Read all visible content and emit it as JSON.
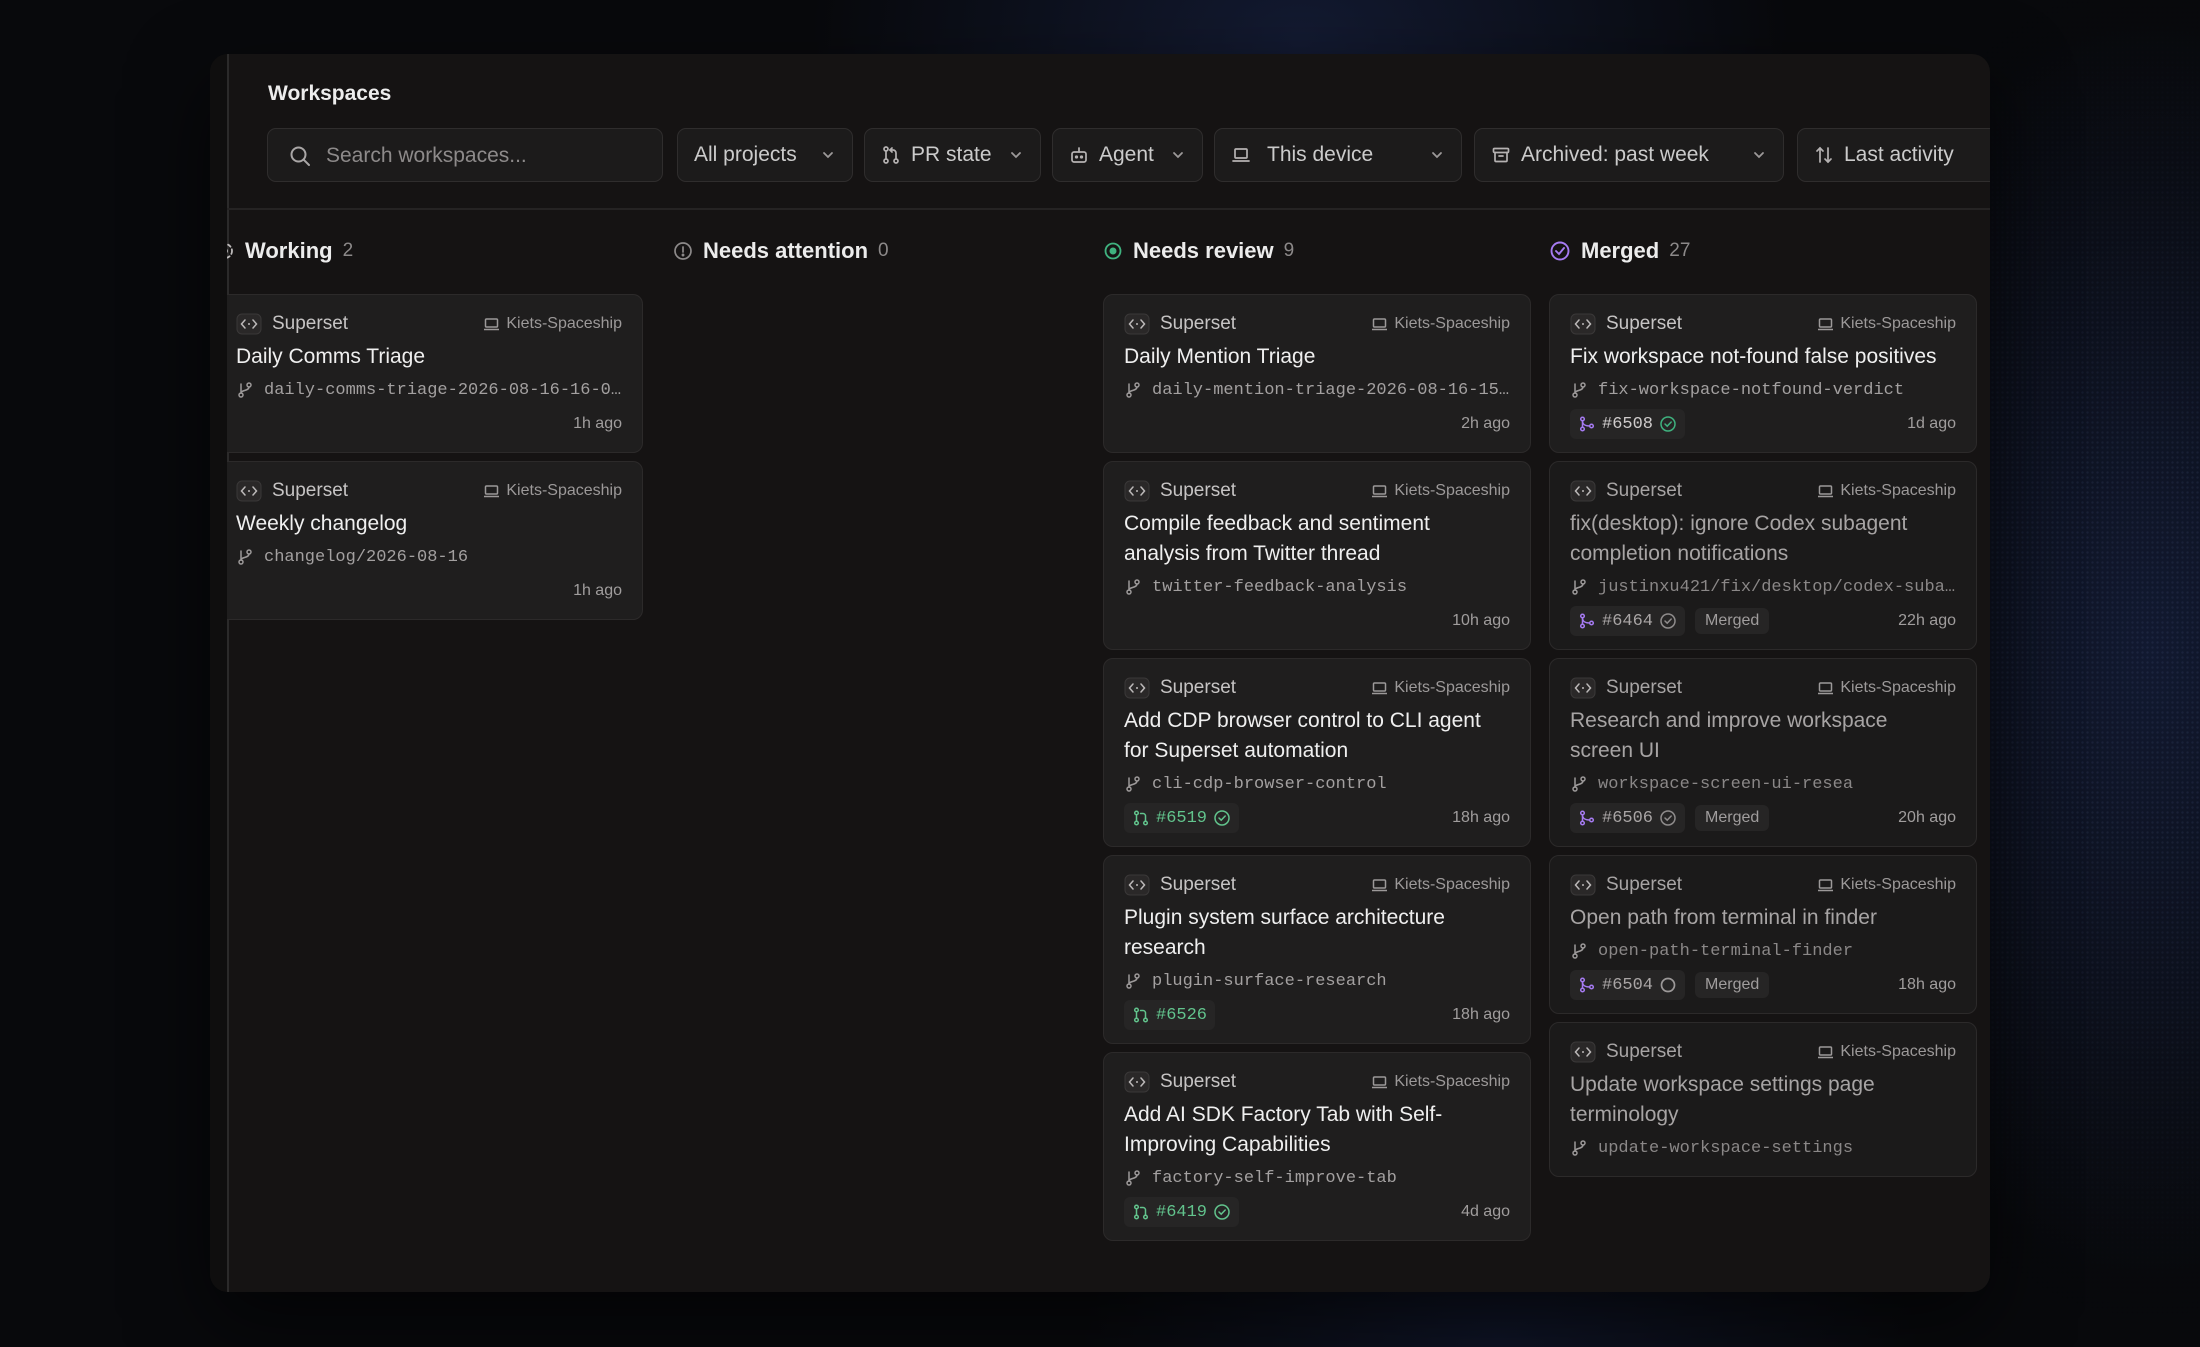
{
  "header": {
    "title": "Workspaces"
  },
  "toolbar": {
    "search_placeholder": "Search workspaces...",
    "filters": {
      "projects": "All projects",
      "pr_state": "PR state",
      "agent": "Agent",
      "device": "This device",
      "archived": "Archived: past week",
      "sort": "Last activity"
    }
  },
  "colors": {
    "accent_open": "#62c48d",
    "accent_review": "#3fb27f",
    "accent_merged": "#a67bf2",
    "card_bg": "#1f1e1e"
  },
  "columns": [
    {
      "title": "Working",
      "count": "2",
      "status_icon": "spinner-icon",
      "cards": [
        {
          "project": "Superset",
          "device": "Kiets-Spaceship",
          "title": "Daily Comms Triage",
          "branch": "daily-comms-triage-2026-08-16-16-0…",
          "time": "1h ago"
        },
        {
          "project": "Superset",
          "device": "Kiets-Spaceship",
          "title": "Weekly changelog",
          "branch": "changelog/2026-08-16",
          "time": "1h ago"
        }
      ]
    },
    {
      "title": "Needs attention",
      "count": "0",
      "status_icon": "alert-circle-icon",
      "cards": []
    },
    {
      "title": "Needs review",
      "count": "9",
      "status_icon": "review-dot-icon",
      "cards": [
        {
          "project": "Superset",
          "device": "Kiets-Spaceship",
          "title": "Daily Mention Triage",
          "branch": "daily-mention-triage-2026-08-16-15…",
          "time": "2h ago"
        },
        {
          "project": "Superset",
          "device": "Kiets-Spaceship",
          "title": "Compile feedback and sentiment analysis from Twitter thread",
          "branch": "twitter-feedback-analysis",
          "time": "10h ago"
        },
        {
          "project": "Superset",
          "device": "Kiets-Spaceship",
          "title": "Add CDP browser control to CLI agent for Superset automation",
          "branch": "cli-cdp-browser-control",
          "pr": "#6519",
          "time": "18h ago"
        },
        {
          "project": "Superset",
          "device": "Kiets-Spaceship",
          "title": "Plugin system surface architecture research",
          "branch": "plugin-surface-research",
          "pr": "#6526",
          "time": "18h ago"
        },
        {
          "project": "Superset",
          "device": "Kiets-Spaceship",
          "title": "Add AI SDK Factory Tab with Self-Improving Capabilities",
          "branch": "factory-self-improve-tab",
          "pr": "#6419",
          "time": "4d ago"
        }
      ]
    },
    {
      "title": "Merged",
      "count": "27",
      "status_icon": "merged-check-icon",
      "cards": [
        {
          "project": "Superset",
          "device": "Kiets-Spaceship",
          "title": "Fix workspace not-found false positives",
          "branch": "fix-workspace-notfound-verdict",
          "pr": "#6508",
          "time": "1d ago"
        },
        {
          "project": "Superset",
          "device": "Kiets-Spaceship",
          "title": "fix(desktop): ignore Codex subagent completion notifications",
          "branch": "justinxu421/fix/desktop/codex-suba…",
          "pr": "#6464",
          "tag": "Merged",
          "time": "22h ago"
        },
        {
          "project": "Superset",
          "device": "Kiets-Spaceship",
          "title": "Research and improve workspace screen UI",
          "branch": "workspace-screen-ui-resea",
          "pr": "#6506",
          "tag": "Merged",
          "time": "20h ago"
        },
        {
          "project": "Superset",
          "device": "Kiets-Spaceship",
          "title": "Open path from terminal in finder",
          "branch": "open-path-terminal-finder",
          "pr": "#6504",
          "tag": "Merged",
          "time": "18h ago"
        },
        {
          "project": "Superset",
          "device": "Kiets-Spaceship",
          "title": "Update workspace settings page terminology",
          "branch": "update-workspace-settings"
        }
      ]
    }
  ]
}
